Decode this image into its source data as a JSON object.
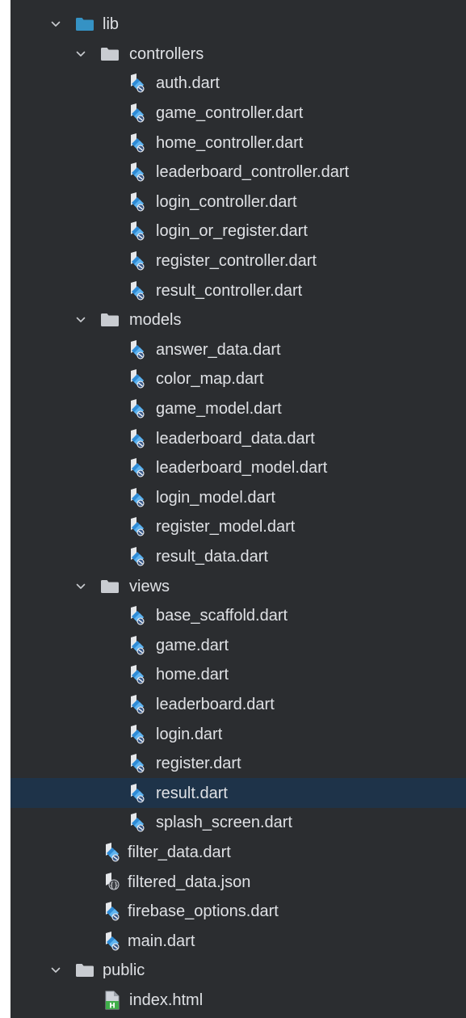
{
  "tree": {
    "lib": {
      "label": "lib",
      "controllers": {
        "label": "controllers",
        "files": [
          "auth.dart",
          "game_controller.dart",
          "home_controller.dart",
          "leaderboard_controller.dart",
          "login_controller.dart",
          "login_or_register.dart",
          "register_controller.dart",
          "result_controller.dart"
        ]
      },
      "models": {
        "label": "models",
        "files": [
          "answer_data.dart",
          "color_map.dart",
          "game_model.dart",
          "leaderboard_data.dart",
          "leaderboard_model.dart",
          "login_model.dart",
          "register_model.dart",
          "result_data.dart"
        ]
      },
      "views": {
        "label": "views",
        "files": [
          "base_scaffold.dart",
          "game.dart",
          "home.dart",
          "leaderboard.dart",
          "login.dart",
          "register.dart",
          "result.dart",
          "splash_screen.dart"
        ],
        "selected": "result.dart"
      },
      "files": [
        {
          "label": "filter_data.dart",
          "icon": "dart-file-icon"
        },
        {
          "label": "filtered_data.json",
          "icon": "json-file-icon"
        },
        {
          "label": "firebase_options.dart",
          "icon": "dart-file-icon"
        },
        {
          "label": "main.dart",
          "icon": "dart-file-icon"
        }
      ]
    },
    "public": {
      "label": "public",
      "files": [
        {
          "label": "index.html",
          "icon": "html-file-icon"
        }
      ]
    }
  },
  "colors": {
    "background": "#2b2d30",
    "selection": "#1e3349",
    "text": "#dfe1e5",
    "source_folder": "#3592c4",
    "folder": "#c9ccd1"
  }
}
